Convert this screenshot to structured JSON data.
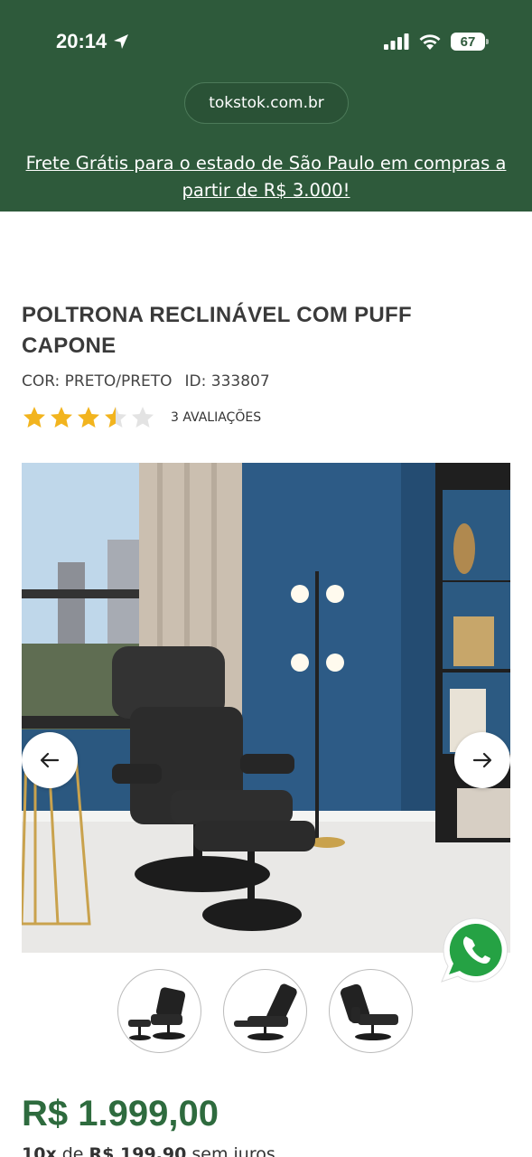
{
  "status_bar": {
    "time": "20:14",
    "battery": "67",
    "location_icon": "location-arrow-icon",
    "signal_icon": "cellular-signal-icon",
    "wifi_icon": "wifi-icon"
  },
  "browser": {
    "url": "tokstok.com.br"
  },
  "banner": {
    "text": "Frete Grátis para o estado de São Paulo em compras a partir de R$ 3.000!"
  },
  "product": {
    "title": "POLTRONA RECLINÁVEL COM PUFF CAPONE",
    "color": "COR: PRETO/PRETO",
    "id": "ID: 333807",
    "rating": 3.5,
    "rating_max": 5,
    "reviews": "3 AVALIAÇÕES",
    "price": "R$ 1.999,00",
    "installments_count": "10x",
    "installments_of": "de",
    "installments_value": "R$ 199,90",
    "installments_suffix": "sem juros"
  },
  "gallery": {
    "thumbnail_count": 3,
    "prev_icon": "arrow-left-icon",
    "next_icon": "arrow-right-icon"
  },
  "colors": {
    "brand_green": "#2e5a3b",
    "price_green": "#2e6b3e",
    "star_gold": "#f2b41e",
    "whatsapp_green": "#25a244"
  }
}
